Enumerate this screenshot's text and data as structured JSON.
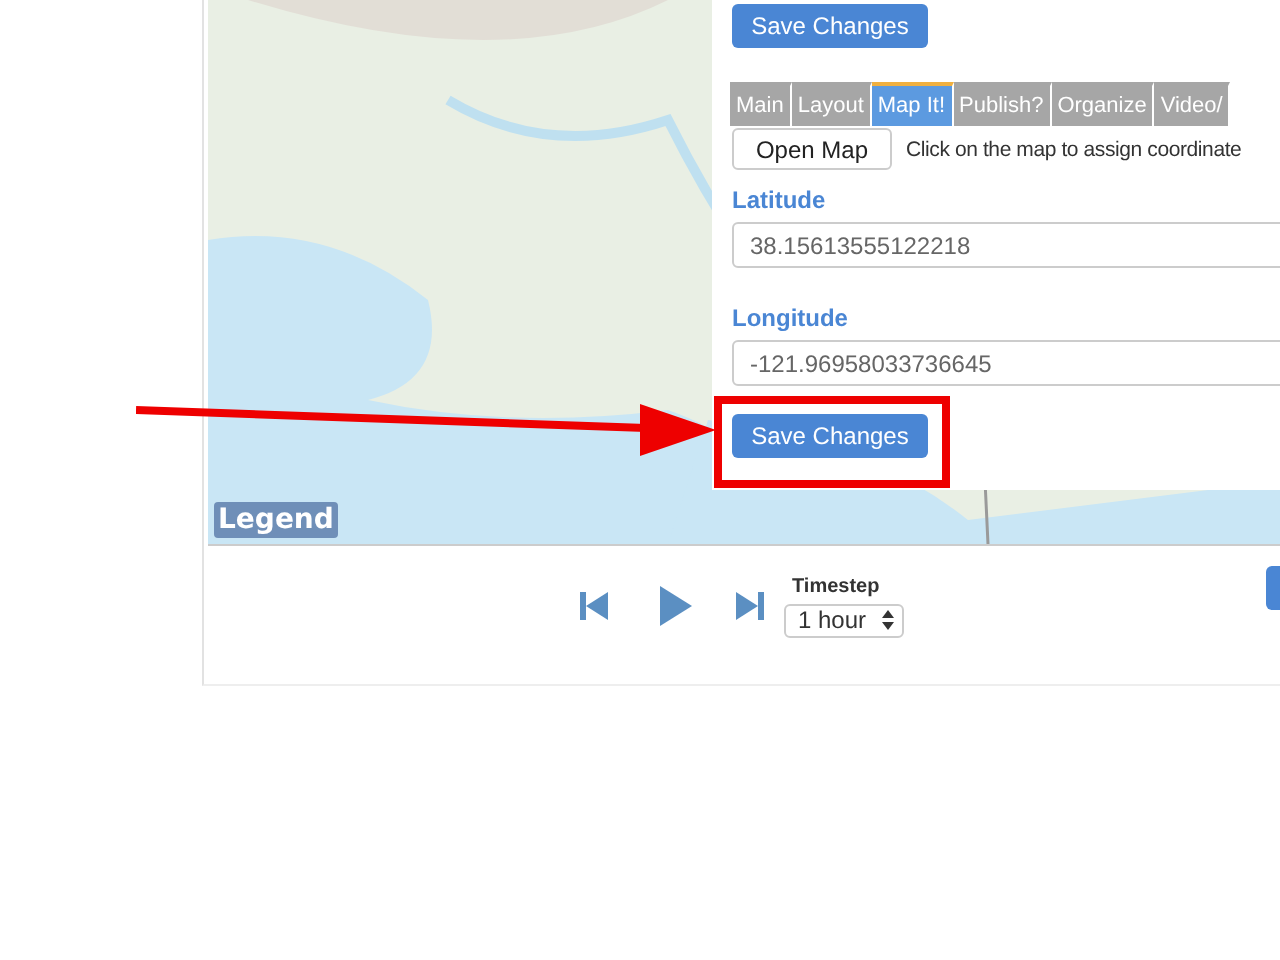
{
  "panel": {
    "save_top": "Save Changes",
    "tabs": [
      {
        "label": "Main",
        "selected": false
      },
      {
        "label": "Layout",
        "selected": false
      },
      {
        "label": "Map It!",
        "selected": true
      },
      {
        "label": "Publish?",
        "selected": false
      },
      {
        "label": "Organize",
        "selected": false
      },
      {
        "label": "Video/",
        "selected": false
      }
    ],
    "open_map": "Open Map",
    "hint": "Click on the map to assign coordinate",
    "fields": [
      {
        "label": "Latitude",
        "value": "38.15613555122218"
      },
      {
        "label": "Longitude",
        "value": "-121.96958033736645"
      }
    ],
    "save_bottom": "Save Changes"
  },
  "map": {
    "legend": "Legend"
  },
  "player": {
    "timestep_label": "Timestep",
    "timestep_value": "1 hour"
  }
}
